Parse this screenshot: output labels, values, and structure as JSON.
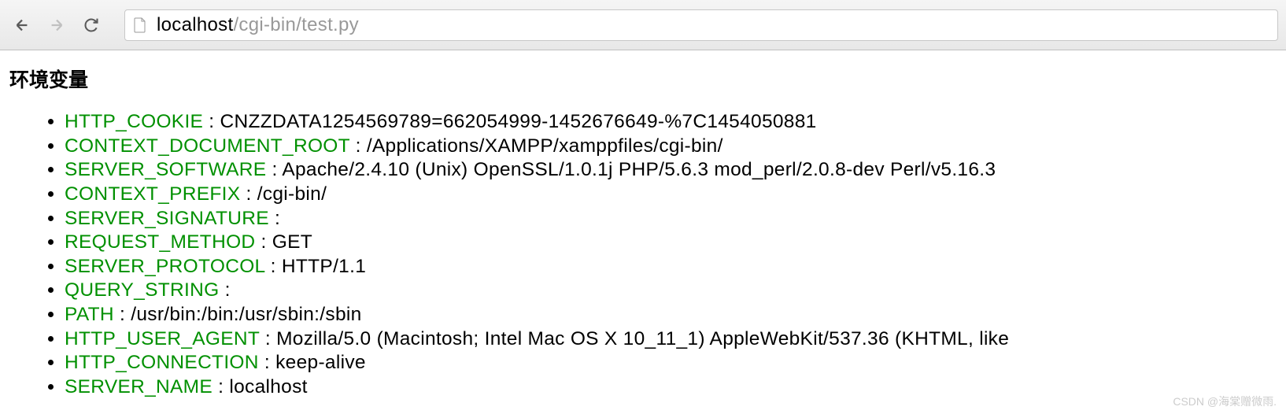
{
  "browser": {
    "url_domain": "localhost",
    "url_path": "/cgi-bin/test.py"
  },
  "page": {
    "heading": "环境变量"
  },
  "env_vars": [
    {
      "key": "HTTP_COOKIE",
      "value": "CNZZDATA1254569789=662054999-1452676649-%7C1454050881"
    },
    {
      "key": "CONTEXT_DOCUMENT_ROOT",
      "value": "/Applications/XAMPP/xamppfiles/cgi-bin/"
    },
    {
      "key": "SERVER_SOFTWARE",
      "value": "Apache/2.4.10 (Unix) OpenSSL/1.0.1j PHP/5.6.3 mod_perl/2.0.8-dev Perl/v5.16.3"
    },
    {
      "key": "CONTEXT_PREFIX",
      "value": "/cgi-bin/"
    },
    {
      "key": "SERVER_SIGNATURE",
      "value": ""
    },
    {
      "key": "REQUEST_METHOD",
      "value": "GET"
    },
    {
      "key": "SERVER_PROTOCOL",
      "value": "HTTP/1.1"
    },
    {
      "key": "QUERY_STRING",
      "value": ""
    },
    {
      "key": "PATH",
      "value": "/usr/bin:/bin:/usr/sbin:/sbin"
    },
    {
      "key": "HTTP_USER_AGENT",
      "value": "Mozilla/5.0 (Macintosh; Intel Mac OS X 10_11_1) AppleWebKit/537.36 (KHTML, like"
    },
    {
      "key": "HTTP_CONNECTION",
      "value": "keep-alive"
    },
    {
      "key": "SERVER_NAME",
      "value": "localhost"
    }
  ],
  "watermark": "CSDN @海棠赠微雨."
}
